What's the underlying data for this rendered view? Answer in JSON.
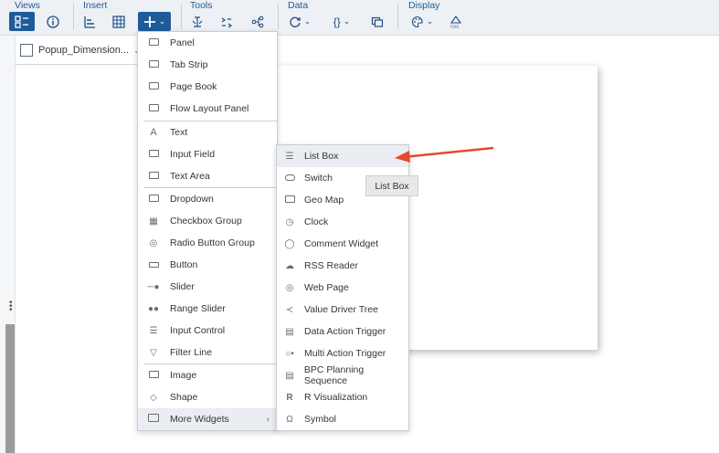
{
  "toolbar": {
    "groups": {
      "views": "Views",
      "insert": "Insert",
      "tools": "Tools",
      "data": "Data",
      "display": "Display"
    },
    "icons": {
      "views_outline": "outline-icon",
      "views_info": "info-icon",
      "insert_chart": "chart-icon",
      "insert_table": "table-icon",
      "insert_add": "add-icon",
      "tools_formula": "formula-icon",
      "tools_compare": "compare-icon",
      "tools_flow": "flow-icon",
      "data_refresh": "refresh-icon",
      "data_script": "script-icon",
      "data_copy": "copy-icon",
      "display_theme": "theme-icon",
      "display_css": "css-icon"
    }
  },
  "page_tab": {
    "label": "Popup_Dimension..."
  },
  "insert_menu": {
    "items": [
      {
        "label": "Panel",
        "icon": "panel-icon"
      },
      {
        "label": "Tab Strip",
        "icon": "tab-strip-icon"
      },
      {
        "label": "Page Book",
        "icon": "page-book-icon"
      },
      {
        "label": "Flow Layout Panel",
        "icon": "flow-layout-icon"
      },
      {
        "label": "Text",
        "icon": "text-icon"
      },
      {
        "label": "Input Field",
        "icon": "input-field-icon"
      },
      {
        "label": "Text Area",
        "icon": "text-area-icon"
      },
      {
        "label": "Dropdown",
        "icon": "dropdown-icon"
      },
      {
        "label": "Checkbox Group",
        "icon": "checkbox-icon"
      },
      {
        "label": "Radio Button Group",
        "icon": "radio-icon"
      },
      {
        "label": "Button",
        "icon": "button-icon"
      },
      {
        "label": "Slider",
        "icon": "slider-icon"
      },
      {
        "label": "Range Slider",
        "icon": "range-slider-icon"
      },
      {
        "label": "Input Control",
        "icon": "input-control-icon"
      },
      {
        "label": "Filter Line",
        "icon": "filter-icon"
      },
      {
        "label": "Image",
        "icon": "image-icon"
      },
      {
        "label": "Shape",
        "icon": "shape-icon"
      },
      {
        "label": "More Widgets",
        "icon": "folder-icon"
      }
    ]
  },
  "more_widgets_menu": {
    "items": [
      {
        "label": "List Box",
        "icon": "list-box-icon"
      },
      {
        "label": "Switch",
        "icon": "switch-icon"
      },
      {
        "label": "Geo Map",
        "icon": "geo-map-icon"
      },
      {
        "label": "Clock",
        "icon": "clock-icon"
      },
      {
        "label": "Comment Widget",
        "icon": "comment-icon"
      },
      {
        "label": "RSS Reader",
        "icon": "rss-icon"
      },
      {
        "label": "Web Page",
        "icon": "globe-icon"
      },
      {
        "label": "Value Driver Tree",
        "icon": "tree-icon"
      },
      {
        "label": "Data Action Trigger",
        "icon": "data-action-icon"
      },
      {
        "label": "Multi Action Trigger",
        "icon": "multi-action-icon"
      },
      {
        "label": "BPC Planning Sequence",
        "icon": "bpc-icon"
      },
      {
        "label": "R Visualization",
        "icon": "r-icon"
      },
      {
        "label": "Symbol",
        "icon": "symbol-icon"
      }
    ]
  },
  "tooltip": {
    "text": "List Box"
  },
  "colors": {
    "toolbar_bg": "#edf0f4",
    "active_button": "#1f5b99",
    "group_label": "#1d5a9a",
    "annotation_arrow": "#e8482f"
  }
}
